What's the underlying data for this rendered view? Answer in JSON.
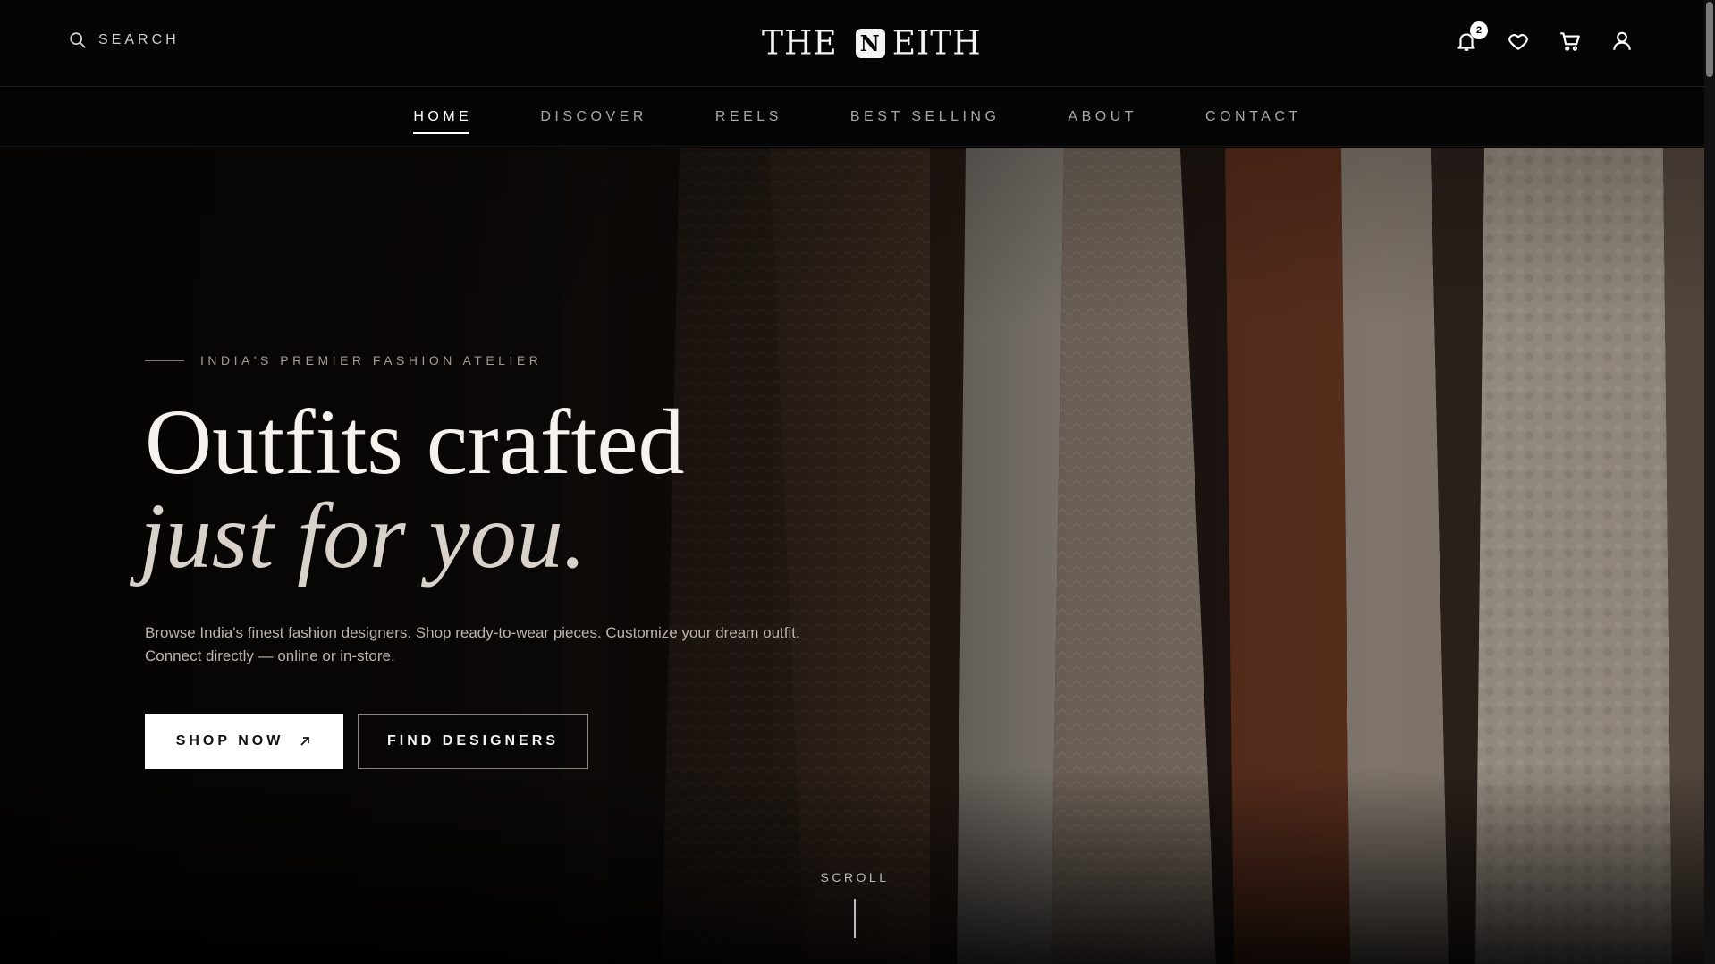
{
  "header": {
    "search_label": "SEARCH",
    "logo_left": "THE",
    "logo_mark": "N",
    "logo_right": "EITH",
    "notification_count": "2",
    "icons": [
      "bell-icon",
      "heart-icon",
      "cart-icon",
      "user-icon",
      "search-icon"
    ]
  },
  "nav": {
    "items": [
      {
        "label": "HOME",
        "active": true
      },
      {
        "label": "DISCOVER"
      },
      {
        "label": "REELS"
      },
      {
        "label": "BEST SELLING"
      },
      {
        "label": "ABOUT"
      },
      {
        "label": "CONTACT"
      }
    ]
  },
  "hero": {
    "eyebrow": "INDIA'S PREMIER FASHION ATELIER",
    "headline_line1": "Outfits crafted",
    "headline_line2": "just for you.",
    "subtext_line1": "Browse India's finest fashion designers. Shop ready-to-wear pieces. Customize your dream outfit.",
    "subtext_line2": "Connect directly — online or in-store.",
    "primary_button": "SHOP NOW",
    "secondary_button": "FIND DESIGNERS",
    "scroll_label": "SCROLL"
  },
  "colors": {
    "background": "#000000",
    "text_primary": "#ffffff",
    "text_muted": "#a8a8a8"
  }
}
